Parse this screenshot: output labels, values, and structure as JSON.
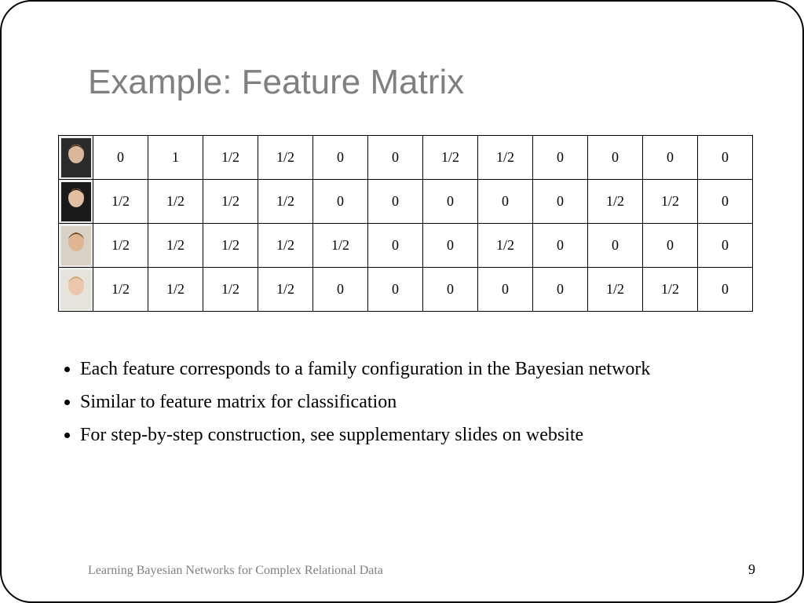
{
  "title": "Example: Feature Matrix",
  "matrix": {
    "rows": [
      {
        "portrait_colors": [
          "#2a2a2a",
          "#d9b79a",
          "#4a3322"
        ],
        "values": [
          "0",
          "1",
          "1/2",
          "1/2",
          "0",
          "0",
          "1/2",
          "1/2",
          "0",
          "0",
          "0",
          "0"
        ]
      },
      {
        "portrait_colors": [
          "#1a1a1a",
          "#e3c0a4",
          "#2b1a10"
        ],
        "values": [
          "1/2",
          "1/2",
          "1/2",
          "1/2",
          "0",
          "0",
          "0",
          "0",
          "0",
          "1/2",
          "1/2",
          "0"
        ]
      },
      {
        "portrait_colors": [
          "#d9d0c6",
          "#e0b592",
          "#6b4a2e"
        ],
        "values": [
          "1/2",
          "1/2",
          "1/2",
          "1/2",
          "1/2",
          "0",
          "0",
          "1/2",
          "0",
          "0",
          "0",
          "0"
        ]
      },
      {
        "portrait_colors": [
          "#e8e3da",
          "#eac7ad",
          "#c9a978"
        ],
        "values": [
          "1/2",
          "1/2",
          "1/2",
          "1/2",
          "0",
          "0",
          "0",
          "0",
          "0",
          "1/2",
          "1/2",
          "0"
        ]
      }
    ]
  },
  "bullets": [
    "Each feature corresponds to a family configuration in the Bayesian network",
    "Similar to feature matrix for classification",
    "For step-by-step construction, see supplementary slides on website"
  ],
  "footer_left": "Learning Bayesian Networks for Complex Relational Data",
  "footer_right": "9"
}
